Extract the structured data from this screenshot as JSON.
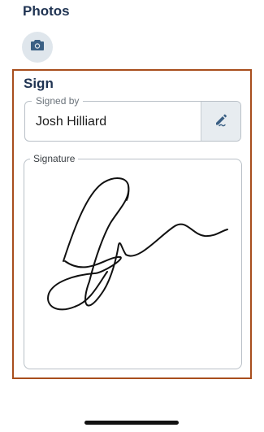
{
  "photos": {
    "title": "Photos",
    "camera_icon": "camera-icon"
  },
  "sign": {
    "title": "Sign",
    "signed_by": {
      "label": "Signed by",
      "value": "Josh Hilliard",
      "edit_icon": "pen-sign-icon"
    },
    "signature": {
      "label": "Signature"
    }
  },
  "colors": {
    "heading": "#1f3352",
    "card_border": "#a84e1d",
    "icon_button_bg": "#dfe6ec",
    "icon_color": "#3a5f84"
  }
}
